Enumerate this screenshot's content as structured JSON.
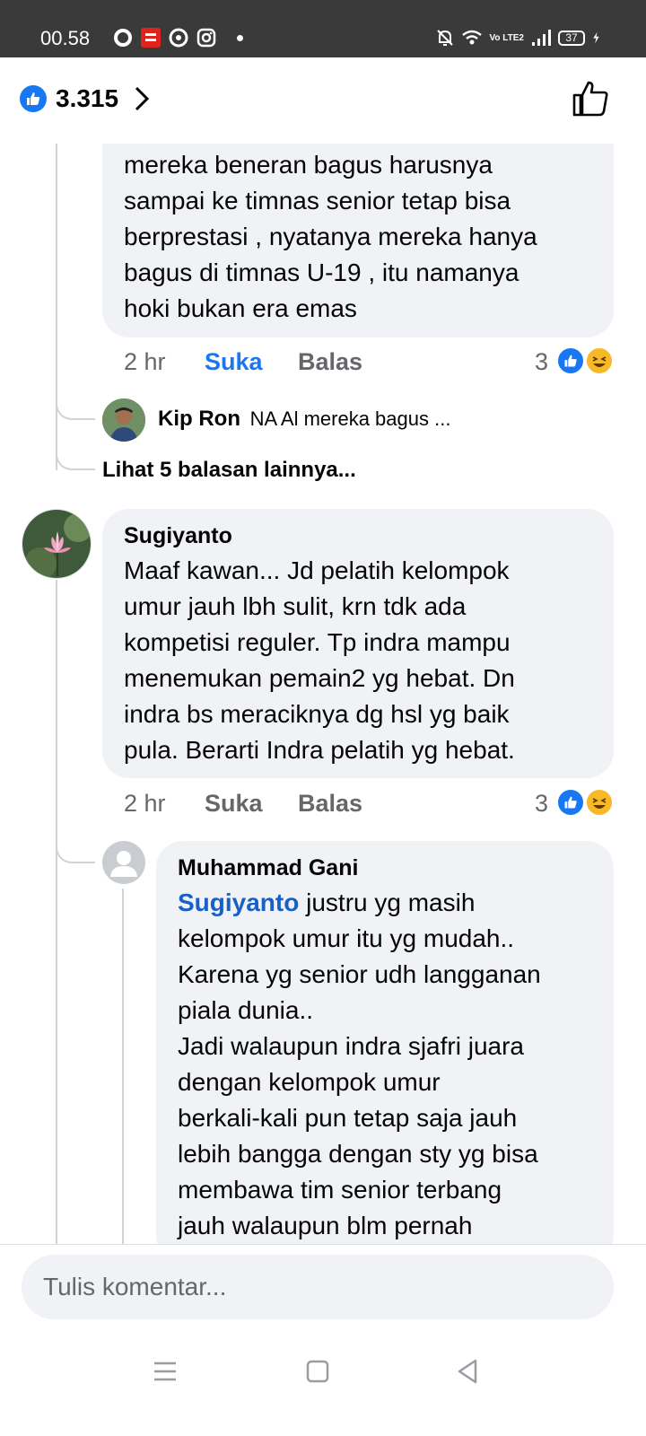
{
  "status_bar": {
    "time": "00.58",
    "network_label": "Vo LTE2",
    "battery": "37"
  },
  "header": {
    "like_count": "3.315"
  },
  "comments": [
    {
      "text_lines": [
        "mereka beneran bagus harusnya",
        "sampai ke timnas senior tetap bisa",
        "berprestasi , nyatanya mereka hanya",
        "bagus di timnas U-19 , itu namanya",
        "hoki bukan era emas"
      ],
      "time": "2 hr",
      "like_label": "Suka",
      "reply_label": "Balas",
      "reaction_count": "3"
    },
    {
      "author": "Sugiyanto",
      "text_lines": [
        "Maaf kawan... Jd pelatih kelompok",
        "umur jauh lbh sulit, krn tdk ada",
        "kompetisi reguler. Tp indra mampu",
        "menemukan pemain2 yg hebat. Dn",
        "indra bs meraciknya dg hsl yg baik",
        "pula. Berarti Indra pelatih yg hebat."
      ],
      "time": "2 hr",
      "like_label": "Suka",
      "reply_label": "Balas",
      "reaction_count": "3"
    }
  ],
  "reply_preview": {
    "author": "Kip Ron",
    "text": "NA Al  mereka bagus ..."
  },
  "more_replies": "Lihat 5 balasan lainnya...",
  "reply": {
    "author": "Muhammad Gani",
    "mention": "Sugiyanto",
    "first_line_rest": " justru yg masih",
    "text_lines": [
      "kelompok umur itu yg mudah..",
      "Karena yg senior udh langganan",
      "piala dunia..",
      "Jadi walaupun indra sjafri juara",
      "dengan kelompok umur",
      "berkali-kali pun tetap saja jauh",
      "lebih bangga dengan sty yg bisa",
      "membawa tim senior terbang",
      "jauh walaupun blm pernah"
    ]
  },
  "composer": {
    "placeholder": "Tulis komentar..."
  },
  "colors": {
    "accent": "#1877f2",
    "bubble": "#f0f2f5",
    "status_bar": "#3a3a3a",
    "meta_text": "#65676b"
  }
}
